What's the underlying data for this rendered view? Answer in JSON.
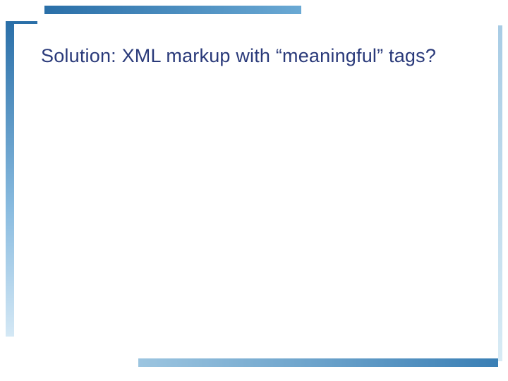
{
  "slide": {
    "title": "Solution: XML markup with “meaningful” tags?"
  }
}
